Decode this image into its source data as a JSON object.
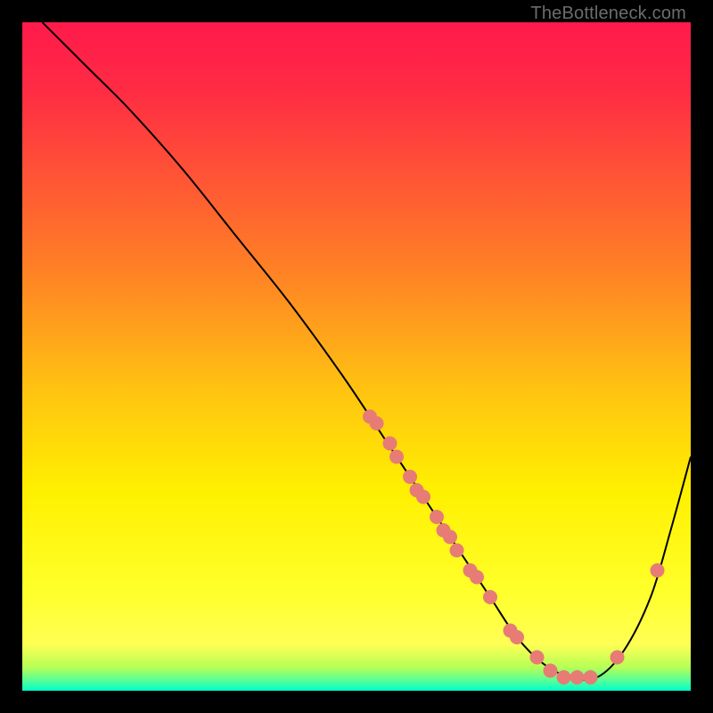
{
  "watermark": "TheBottleneck.com",
  "gradient": {
    "stops": [
      {
        "offset": 0.0,
        "color": "#ff1a4b"
      },
      {
        "offset": 0.1,
        "color": "#ff2b44"
      },
      {
        "offset": 0.25,
        "color": "#ff5a33"
      },
      {
        "offset": 0.4,
        "color": "#ff8b22"
      },
      {
        "offset": 0.55,
        "color": "#ffc311"
      },
      {
        "offset": 0.7,
        "color": "#fff000"
      },
      {
        "offset": 0.85,
        "color": "#ffff2a"
      },
      {
        "offset": 0.93,
        "color": "#ffff55"
      },
      {
        "offset": 0.965,
        "color": "#b6ff55"
      },
      {
        "offset": 0.985,
        "color": "#55ff99"
      },
      {
        "offset": 1.0,
        "color": "#00ffcc"
      }
    ]
  },
  "chart_data": {
    "type": "line",
    "title": "",
    "xlabel": "",
    "ylabel": "",
    "xlim": [
      0,
      100
    ],
    "ylim": [
      0,
      100
    ],
    "series": [
      {
        "name": "curve",
        "x": [
          3,
          6,
          10,
          16,
          24,
          32,
          40,
          48,
          54,
          58,
          62,
          66,
          70,
          74,
          78,
          82,
          86,
          90,
          94,
          97,
          100
        ],
        "y": [
          100,
          97,
          93,
          87,
          78,
          68,
          58,
          47,
          38,
          32,
          26,
          20,
          14,
          8,
          4,
          2,
          2,
          6,
          14,
          24,
          35
        ]
      }
    ],
    "scatter": {
      "name": "markers",
      "points": [
        {
          "x": 52,
          "y": 41
        },
        {
          "x": 53,
          "y": 40
        },
        {
          "x": 55,
          "y": 37
        },
        {
          "x": 56,
          "y": 35
        },
        {
          "x": 58,
          "y": 32
        },
        {
          "x": 59,
          "y": 30
        },
        {
          "x": 60,
          "y": 29
        },
        {
          "x": 62,
          "y": 26
        },
        {
          "x": 63,
          "y": 24
        },
        {
          "x": 64,
          "y": 23
        },
        {
          "x": 65,
          "y": 21
        },
        {
          "x": 67,
          "y": 18
        },
        {
          "x": 68,
          "y": 17
        },
        {
          "x": 70,
          "y": 14
        },
        {
          "x": 73,
          "y": 9
        },
        {
          "x": 74,
          "y": 8
        },
        {
          "x": 77,
          "y": 5
        },
        {
          "x": 79,
          "y": 3
        },
        {
          "x": 81,
          "y": 2
        },
        {
          "x": 83,
          "y": 2
        },
        {
          "x": 85,
          "y": 2
        },
        {
          "x": 89,
          "y": 5
        },
        {
          "x": 95,
          "y": 18
        }
      ],
      "color": "#e77b76",
      "radius": 8
    },
    "curve_style": {
      "stroke": "#000000",
      "width": 2
    }
  }
}
